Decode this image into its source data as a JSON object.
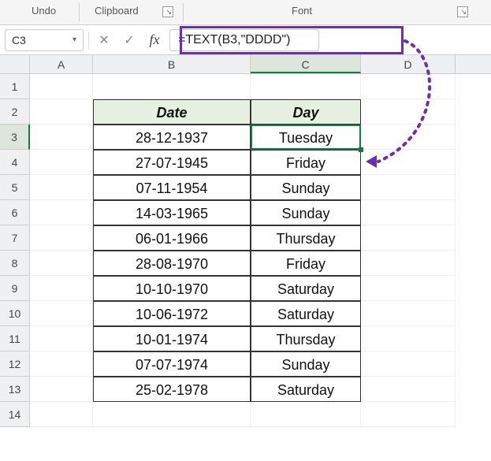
{
  "ribbon": {
    "undo": "Undo",
    "clipboard": "Clipboard",
    "font": "Font"
  },
  "formula_bar": {
    "namebox_value": "C3",
    "cancel_glyph": "✕",
    "enter_glyph": "✓",
    "fx_glyph": "fx",
    "formula": "=TEXT(B3,\"DDDD\")"
  },
  "columns": [
    "A",
    "B",
    "C",
    "D"
  ],
  "row_numbers": [
    "1",
    "2",
    "3",
    "4",
    "5",
    "6",
    "7",
    "8",
    "9",
    "10",
    "11",
    "12",
    "13",
    "14"
  ],
  "table": {
    "headers": {
      "date": "Date",
      "day": "Day"
    },
    "rows": [
      {
        "date": "28-12-1937",
        "day": "Tuesday"
      },
      {
        "date": "27-07-1945",
        "day": "Friday"
      },
      {
        "date": "07-11-1954",
        "day": "Sunday"
      },
      {
        "date": "14-03-1965",
        "day": "Sunday"
      },
      {
        "date": "06-01-1966",
        "day": "Thursday"
      },
      {
        "date": "28-08-1970",
        "day": "Friday"
      },
      {
        "date": "10-10-1970",
        "day": "Saturday"
      },
      {
        "date": "10-06-1972",
        "day": "Saturday"
      },
      {
        "date": "10-01-1974",
        "day": "Thursday"
      },
      {
        "date": "07-07-1974",
        "day": "Sunday"
      },
      {
        "date": "25-02-1978",
        "day": "Saturday"
      }
    ]
  },
  "active_cell": "C3",
  "colors": {
    "accent": "#107c41",
    "annotation": "#6a2fb5"
  }
}
